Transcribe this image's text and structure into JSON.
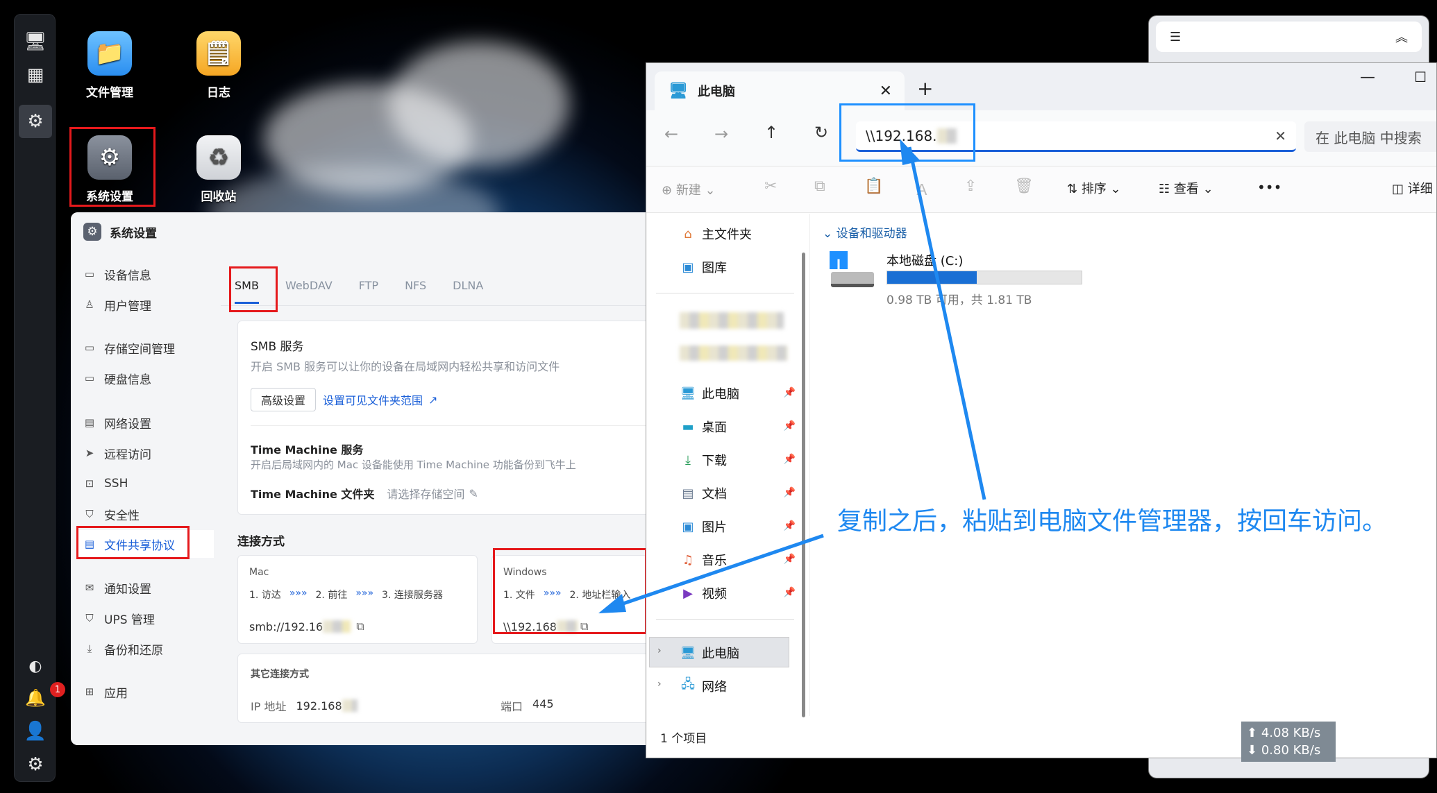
{
  "desktop": {
    "icons": [
      {
        "label": "文件管理",
        "icon": "folder-icon"
      },
      {
        "label": "日志",
        "icon": "notes-icon"
      },
      {
        "label": "系统设置",
        "icon": "settings-gear-icon"
      },
      {
        "label": "回收站",
        "icon": "recycle-bin-icon"
      }
    ]
  },
  "dock": {
    "icons": [
      "monitor-icon",
      "apps-grid-icon",
      "settings-icon",
      "speed-icon",
      "bell-icon",
      "user-icon",
      "gear-icon"
    ],
    "notification_count": "1"
  },
  "settings": {
    "title": "系统设置",
    "nav": [
      {
        "label": "设备信息",
        "icon": "device-icon"
      },
      {
        "label": "用户管理",
        "icon": "user-icon"
      },
      {
        "label": "存储空间管理",
        "icon": "storage-icon"
      },
      {
        "label": "硬盘信息",
        "icon": "disk-icon"
      },
      {
        "label": "网络设置",
        "icon": "network-icon"
      },
      {
        "label": "远程访问",
        "icon": "send-icon"
      },
      {
        "label": "SSH",
        "icon": "terminal-icon"
      },
      {
        "label": "安全性",
        "icon": "shield-icon"
      },
      {
        "label": "文件共享协议",
        "icon": "file-icon"
      },
      {
        "label": "通知设置",
        "icon": "mail-icon"
      },
      {
        "label": "UPS 管理",
        "icon": "shield-icon"
      },
      {
        "label": "备份和还原",
        "icon": "download-icon"
      },
      {
        "label": "应用",
        "icon": "apps-icon"
      }
    ],
    "tabs": [
      "SMB",
      "WebDAV",
      "FTP",
      "NFS",
      "DLNA"
    ],
    "smb": {
      "title": "SMB 服务",
      "desc": "开启 SMB 服务可以让你的设备在局域网内轻松共享和访问文件",
      "advanced_btn": "高级设置",
      "visible_link": "设置可见文件夹范围",
      "tm_title": "Time Machine 服务",
      "tm_desc": "开启后局域网内的 Mac 设备能使用 Time Machine 功能备份到飞牛上",
      "tm_folder_label": "Time Machine 文件夹",
      "tm_folder_value": "请选择存储空间"
    },
    "connect": {
      "title": "连接方式",
      "mac": {
        "title": "Mac",
        "step1": "1. 访达",
        "step2": "2. 前往",
        "step3": "3. 连接服务器",
        "address": "smb://192.16"
      },
      "windows": {
        "title": "Windows",
        "step1": "1. 文件",
        "step2": "2. 地址栏输入",
        "address": "\\\\192.168"
      },
      "arrows": "»»»"
    },
    "other": {
      "title": "其它连接方式",
      "ip_label": "IP 地址",
      "ip_value": "192.168",
      "port_label": "端口",
      "port_value": "445"
    }
  },
  "explorer": {
    "tab_title": "此电脑",
    "address": "\\\\192.168.",
    "search_placeholder": "在 此电脑 中搜索",
    "cmd": {
      "new": "新建",
      "sort": "排序",
      "view": "查看",
      "more": "•••",
      "details": "详细"
    },
    "nav": [
      {
        "label": "主文件夹",
        "icon": "home-icon"
      },
      {
        "label": "图库",
        "icon": "gallery-icon"
      },
      {
        "label": "此电脑",
        "icon": "pc-icon"
      },
      {
        "label": "桌面",
        "icon": "desktop-icon"
      },
      {
        "label": "下载",
        "icon": "download-icon"
      },
      {
        "label": "文档",
        "icon": "document-icon"
      },
      {
        "label": "图片",
        "icon": "picture-icon"
      },
      {
        "label": "音乐",
        "icon": "music-icon"
      },
      {
        "label": "视频",
        "icon": "video-icon"
      },
      {
        "label": "此电脑",
        "icon": "pc-icon"
      },
      {
        "label": "网络",
        "icon": "network-icon"
      }
    ],
    "section_title": "设备和驱动器",
    "drive": {
      "name": "本地磁盘 (C:)",
      "space": "0.98 TB 可用，共 1.81 TB",
      "used_fraction": 0.46
    },
    "status": "1 个项目"
  },
  "annotation": "复制之后，粘贴到电脑文件管理器，按回车访问。",
  "network_speed": {
    "up": "4.08 KB/s",
    "down": "0.80 KB/s"
  }
}
